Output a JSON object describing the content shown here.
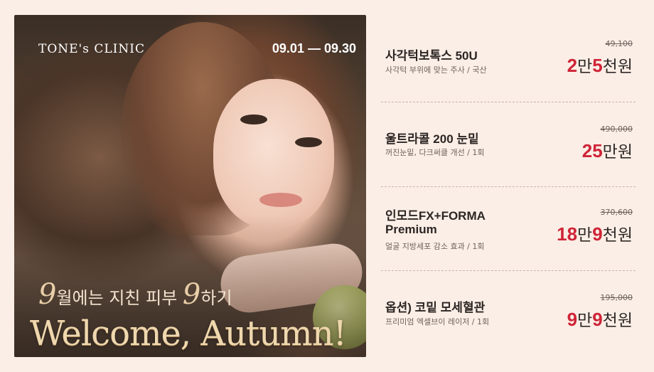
{
  "hero": {
    "logo": "TONE's CLINIC",
    "date_range": "09.01 — 09.30",
    "tagline_num1": "9",
    "tagline_mid": "월에는 지친 피부 ",
    "tagline_num2": "9",
    "tagline_end": "하기",
    "welcome": "Welcome, Autumn!"
  },
  "items": [
    {
      "name": "사각턱보톡스 50U",
      "desc": "사각턱 부위에 맞는 주사 / 국산",
      "original_price": "49,100",
      "price": [
        {
          "t": "2",
          "kind": "num"
        },
        {
          "t": "만",
          "kind": "unit"
        },
        {
          "t": "5",
          "kind": "num"
        },
        {
          "t": "천원",
          "kind": "unit"
        }
      ]
    },
    {
      "name": "울트라콜 200 눈밑",
      "desc": "꺼진눈밑, 다크써클 개선 / 1회",
      "original_price": "490,000",
      "price": [
        {
          "t": "25",
          "kind": "num"
        },
        {
          "t": "만원",
          "kind": "unit"
        }
      ]
    },
    {
      "name_line1": "인모드FX+FORMA",
      "name_line2": "Premium",
      "desc": "얼굴 지방세포 감소 효과 / 1회",
      "original_price": "370,600",
      "price": [
        {
          "t": "18",
          "kind": "num"
        },
        {
          "t": "만",
          "kind": "unit"
        },
        {
          "t": "9",
          "kind": "num"
        },
        {
          "t": "천원",
          "kind": "unit"
        }
      ]
    },
    {
      "name": "옵션) 코밑 모세혈관",
      "desc": "프리미엄 엑셀브이 레이저 / 1회",
      "original_price": "195,000",
      "price": [
        {
          "t": "9",
          "kind": "num"
        },
        {
          "t": "만",
          "kind": "unit"
        },
        {
          "t": "9",
          "kind": "num"
        },
        {
          "t": "천원",
          "kind": "unit"
        }
      ]
    }
  ],
  "colors": {
    "background": "#fbeee6",
    "price_accent": "#cf2437"
  }
}
